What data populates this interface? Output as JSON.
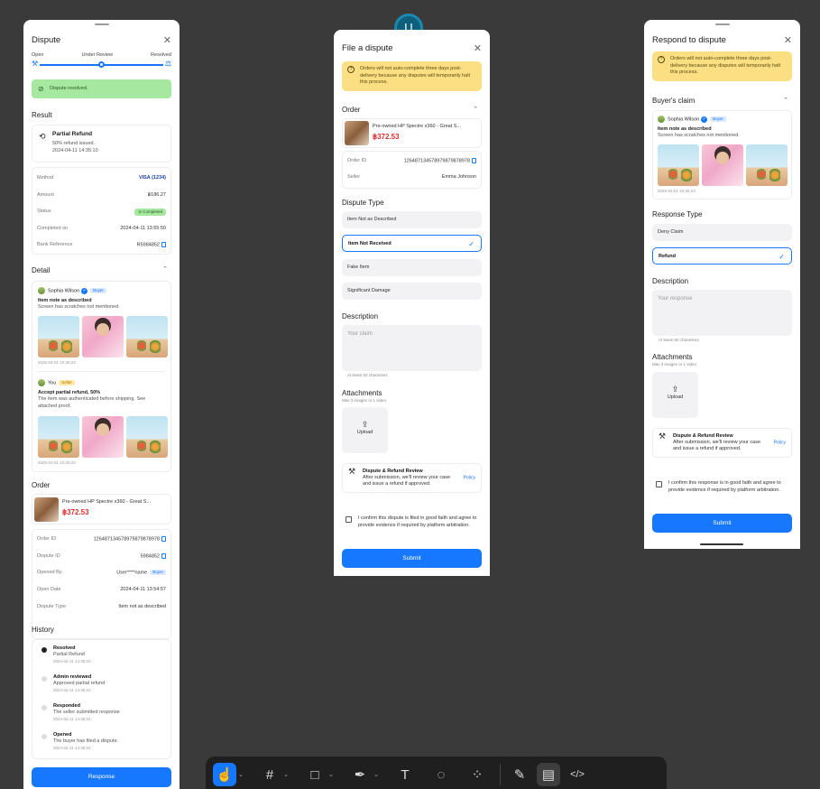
{
  "colors": {
    "primary": "#1677ff",
    "warning_bg": "#fbdf82",
    "success_bg": "#a7e8a0",
    "canvas": "#3a3a3a"
  },
  "user_badge": "U",
  "panel1": {
    "title": "Dispute",
    "steps": [
      "Open",
      "Under Review",
      "Resolved"
    ],
    "resolved_banner": "Dispute resolved.",
    "result_heading": "Result",
    "result": {
      "title": "Partial Refund",
      "line1": "50% refund issued.",
      "line2": "2024-04-11 14:35:10"
    },
    "payment": [
      {
        "k": "Method",
        "v": "VISA (1234)"
      },
      {
        "k": "Amount",
        "v": "฿186.27"
      },
      {
        "k": "Status",
        "v": "Completed"
      },
      {
        "k": "Completed on",
        "v": "2024-04-11 13:55:50"
      },
      {
        "k": "Bank Reference",
        "v": "R5984852"
      }
    ],
    "detail_heading": "Detail",
    "buyer": {
      "name": "Sophia Wilson",
      "badge": "Buyer",
      "title": "Item note as described",
      "desc": "Screen has scratches not mentioned.",
      "date": "2025-04-01 10:25:23"
    },
    "seller": {
      "name": "You",
      "badge": "Seller",
      "title": "Accept partial refund, 50%",
      "desc": "The item was authenticated before shipping. See attached proof.",
      "date": "2025-04-01 10:25:23"
    },
    "order_heading": "Order",
    "product": {
      "name": "Pre-owned HP Spectre x360 - Great S...",
      "price": "฿372.53"
    },
    "order_info": [
      {
        "k": "Order ID",
        "v": "126487134578979879878978"
      },
      {
        "k": "Dispute ID",
        "v": "5984852"
      },
      {
        "k": "Opened By",
        "v": "User****name",
        "badge": "Buyer"
      },
      {
        "k": "Open Date",
        "v": "2024-04-11 13:54:57"
      },
      {
        "k": "Dispute Type",
        "v": "Item not as described"
      }
    ],
    "history_heading": "History",
    "history": [
      {
        "title": "Resolved",
        "desc": "Partial Refund",
        "time": "2024-04-11 14:35:10"
      },
      {
        "title": "Admin reviewed",
        "desc": "Approved partial refund",
        "time": "2024-04-11 14:35:10"
      },
      {
        "title": "Responded",
        "desc": "The seller submitted response",
        "time": "2024-04-11 14:35:10"
      },
      {
        "title": "Opened",
        "desc": "The buyer has filed a dispute.",
        "time": "2024-04-11 14:35:10"
      }
    ],
    "button": "Response"
  },
  "panel2": {
    "title": "File a dispute",
    "warning": "Orders will not auto-complete three days post-delivery because any disputes will temporarily halt this process.",
    "order_heading": "Order",
    "product": {
      "name": "Pre-owned HP Spectre x360 - Great S...",
      "price": "฿372.53"
    },
    "order_id_k": "Order ID",
    "order_id_v": "126487134578979879878978",
    "seller_k": "Seller",
    "seller_v": "Emma Johnson",
    "type_heading": "Dispute Type",
    "types": [
      "Item Not as Described",
      "Item Not Received",
      "Fake Item",
      "Significant Damage"
    ],
    "selected_type": 1,
    "desc_heading": "Description",
    "desc_placeholder": "Your claim",
    "desc_hint": "At lease 50 characters",
    "attach_heading": "Attachments",
    "attach_hint": "Max 3 images or 1 video",
    "upload": "Upload",
    "policy_title": "Dispute & Refund Review",
    "policy_text": "After submission, we'll review your case and issue a refund if approved.",
    "policy_link": "Policy",
    "confirm": "I confirm this dispute is filed in good faith and agree to provide evidence if required by platform arbitration.",
    "button": "Submit"
  },
  "panel3": {
    "title": "Respond to dispute",
    "warning": "Orders will not auto-complete three days post-delivery because any disputes will temporarily halt this process.",
    "claim_heading": "Buyer's claim",
    "buyer": {
      "name": "Sophia Wilson",
      "badge": "Buyer",
      "title": "Item note as described",
      "desc": "Screen has scratches not mentioned.",
      "date": "2025-04-01 10:25:23"
    },
    "response_heading": "Response Type",
    "types": [
      "Deny Claim",
      "Refund"
    ],
    "selected_type": 1,
    "desc_heading": "Description",
    "desc_placeholder": "Your response",
    "desc_hint": "At lease 50 characters",
    "attach_heading": "Attachments",
    "attach_hint": "Max 3 images or 1 video",
    "upload": "Upload",
    "policy_title": "Dispute & Refund Review",
    "policy_text": "After submission, we'll review your case and issue a refund if approved.",
    "policy_link": "Policy",
    "confirm": "I confirm this response is in good faith and agree to provide evidence if required by platform arbitration.",
    "button": "Submit"
  },
  "toolbar": {
    "tools": [
      "hand-tool",
      "frame-tool",
      "rectangle-tool",
      "pen-tool",
      "text-tool",
      "comment-tool",
      "components-tool",
      "draw-mode",
      "design-mode",
      "code-mode"
    ]
  }
}
